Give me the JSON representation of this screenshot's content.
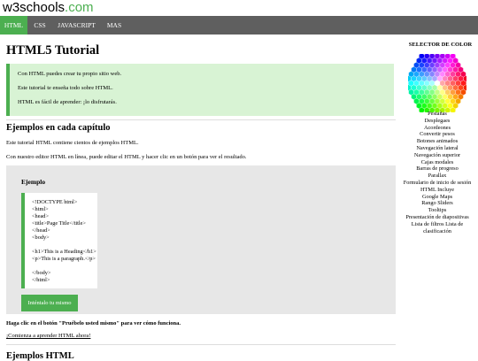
{
  "logo": {
    "text": "w3schools",
    "suffix": ".com"
  },
  "nav": {
    "items": [
      "HTML",
      "CSS",
      "JAVASCRIPT",
      "MAS"
    ]
  },
  "main": {
    "title": "HTML5 Tutorial",
    "note": [
      "Con HTML puedes crear tu propio sitio web.",
      "Este tutorial te enseña todo sobre HTML.",
      "HTML es fácil de aprender: ¡lo disfrutarás."
    ],
    "section_title": "Ejemplos en cada capítulo",
    "para1": "Este tutorial HTML contiene cientos de ejemplos HTML.",
    "para2": "Con nuestro editor HTML en línea, puede editar el HTML y hacer clic en un botón para ver el resultado.",
    "example_title": "Ejemplo",
    "code_lines": [
      "<!DOCTYPE html>",
      "<html>",
      "<head>",
      "<title>Page Title</title>",
      "</head>",
      "<body>",
      "",
      "<h1>This is a Heading</h1>",
      "<p>This is a paragraph.</p>",
      "",
      "</body>",
      "</html>"
    ],
    "try_button": "Inténtalo tu mismo",
    "hint": "Haga clic en el botón \"Pruébelo usted mismo\" para ver cómo funciona.",
    "start_link": "¡Comienza a aprender HTML ahora!",
    "next_section_title": "Ejemplos HTML"
  },
  "sidebar": {
    "title": "SELECTOR DE COLOR",
    "links": [
      "Pestañas",
      "Desplegaes",
      "Acordeones",
      "Convertir pesos",
      "Botones animados",
      "Navegación lateral",
      "Navegación superior",
      "Cajas modales",
      "Barras de progreso",
      "Parallax",
      "Formulario de inicio de sesión",
      "HTML Incluye",
      "Google Maps",
      "Rango Sliders",
      "Tooltips",
      "Presentación de diapositivas",
      "Lista de filtros Lista de clasificación"
    ]
  },
  "colors": {
    "accent": "#4CAF50",
    "nav_bg": "#5f5f5f",
    "note_bg": "#d8f3d4",
    "example_bg": "#e7e7e7"
  }
}
